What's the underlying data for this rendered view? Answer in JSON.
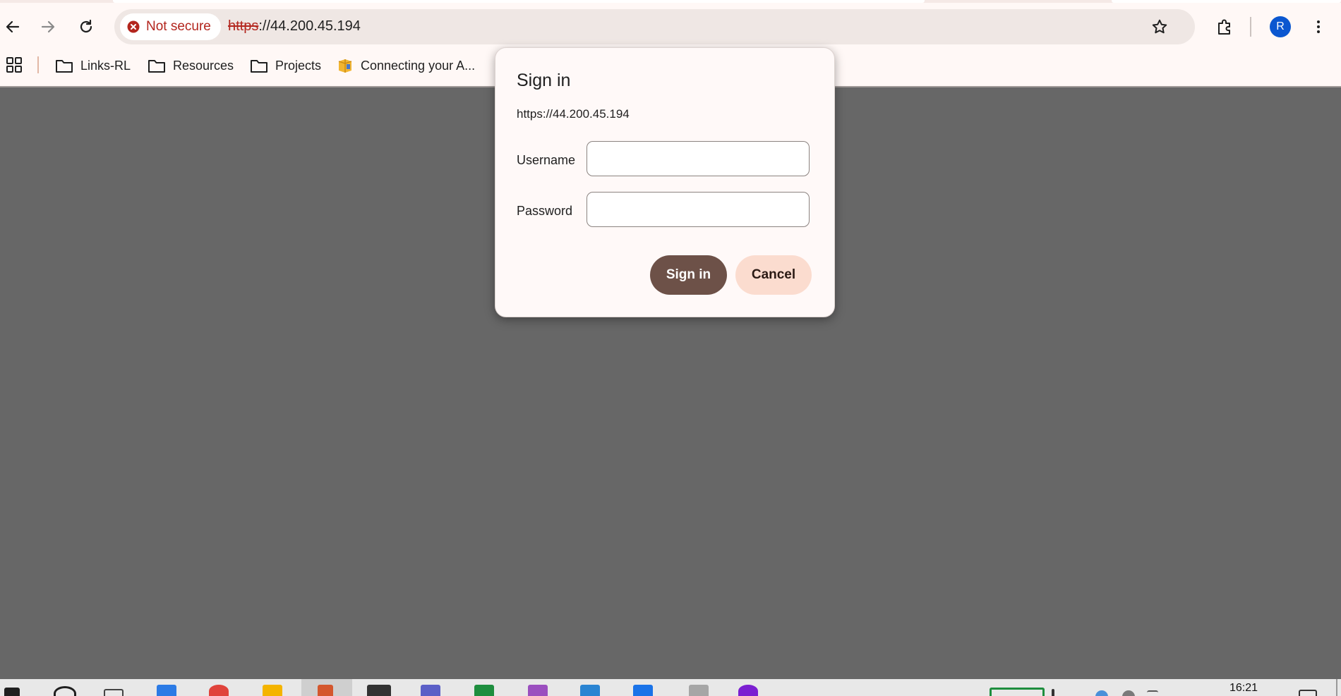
{
  "browser": {
    "security_chip_label": "Not secure",
    "url_scheme": "https",
    "url_rest": "://44.200.45.194",
    "profile_initial": "R"
  },
  "bookmarks": [
    {
      "label": "Links-RL",
      "icon": "folder-icon"
    },
    {
      "label": "Resources",
      "icon": "folder-icon"
    },
    {
      "label": "Projects",
      "icon": "folder-icon"
    },
    {
      "label": "Connecting your A...",
      "icon": "bookmark-page-icon"
    }
  ],
  "dialog": {
    "title": "Sign in",
    "origin": "https://44.200.45.194",
    "username_label": "Username",
    "username_value": "",
    "password_label": "Password",
    "password_value": "",
    "signin_label": "Sign in",
    "cancel_label": "Cancel"
  },
  "taskbar": {
    "clock_time": "16:21"
  },
  "colors": {
    "accent_button": "#6d5148",
    "secondary_button": "#fbdccf",
    "not_secure_red": "#b3261e",
    "profile_avatar": "#0b57d0",
    "backdrop": "#676767"
  }
}
